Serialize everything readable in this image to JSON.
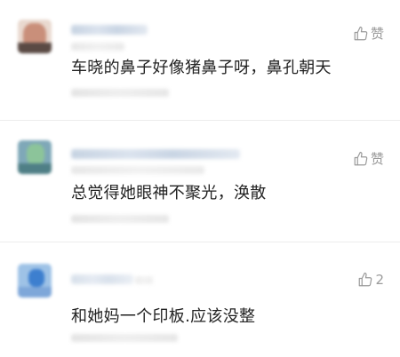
{
  "comments": [
    {
      "text": "车晓的鼻子好像猪鼻子呀，鼻孔朝天",
      "like_label": "赞"
    },
    {
      "text": "总觉得她眼神不聚光，涣散",
      "like_label": "赞"
    },
    {
      "text": "和她妈一个印板.应该没整",
      "like_label": "2"
    }
  ],
  "colors": {
    "text": "#222222",
    "muted": "#9a9a9a",
    "blur_name": "#c9d5e4"
  },
  "icons": [
    "thumbs-up-icon"
  ]
}
